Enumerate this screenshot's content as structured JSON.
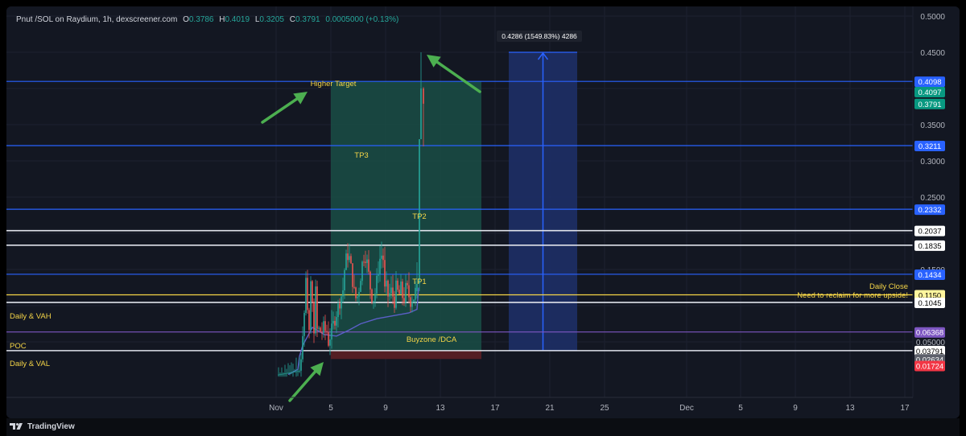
{
  "header": {
    "symbol": "Pnut /SOL on Raydium, 1h, dexscreener.com",
    "o_label": "O",
    "o_value": "0.3786",
    "h_label": "H",
    "h_value": "0.4019",
    "l_label": "L",
    "l_value": "0.3205",
    "c_label": "C",
    "c_value": "0.3791",
    "change": "0.0005000 (+0.13%)"
  },
  "footer": {
    "brand": "TradingView"
  },
  "colors": {
    "background": "#131722",
    "blue_line": "#2962ff",
    "white_line": "#e0e3eb",
    "poc_line": "#7e57c2",
    "vwap_line": "#5b5fc7",
    "target_box": "#1a4d45",
    "stop_box": "#5c1f25",
    "measure_box": "#1e2f66",
    "green_price": "#089981",
    "red_price": "#f23645",
    "label_yellow": "#f5d547",
    "arrow_green": "#4caf50",
    "candle_up": "#26a69a",
    "candle_down": "#ef5350"
  },
  "chart_data": {
    "type": "candlestick",
    "title": "Pnut /SOL on Raydium, 1h, dexscreener.com",
    "y_ticks": [
      "0.5000",
      "0.4500",
      "0.4000",
      "0.3500",
      "0.3000",
      "0.2500",
      "0.1500",
      "0.05000"
    ],
    "x_ticks": [
      "Nov",
      "5",
      "9",
      "13",
      "17",
      "21",
      "25",
      "Dec",
      "5",
      "9",
      "13",
      "17"
    ],
    "price_range": [
      0.0,
      0.5
    ],
    "horizontal_levels": [
      {
        "value": 0.4098,
        "label": "0.4098",
        "style": "blue"
      },
      {
        "value": 0.3211,
        "label": "0.3211",
        "style": "blue"
      },
      {
        "value": 0.2332,
        "label": "0.2332",
        "style": "blue"
      },
      {
        "value": 0.2037,
        "label": "0.2037",
        "style": "white"
      },
      {
        "value": 0.1835,
        "label": "0.1835",
        "style": "white"
      },
      {
        "value": 0.1434,
        "label": "0.1434",
        "style": "blue"
      },
      {
        "value": 0.115,
        "label": "0.1150",
        "style": "yellow"
      },
      {
        "value": 0.1045,
        "label": "0.1045",
        "style": "white"
      },
      {
        "value": 0.06368,
        "label": "0.06368",
        "style": "purple"
      },
      {
        "value": 0.03791,
        "label": "0.03791",
        "style": "white"
      }
    ],
    "price_badges": [
      {
        "value": 0.4097,
        "label": "0.4097",
        "style": "green"
      },
      {
        "value": 0.3791,
        "label": "0.3791",
        "style": "green"
      },
      {
        "value": 0.02634,
        "label": "0.02634",
        "style": "gray"
      },
      {
        "value": 0.01724,
        "label": "0.01724",
        "style": "red"
      }
    ],
    "annotations": {
      "higher_target": "Higher Target",
      "tp3": "TP3",
      "tp2": "TP2",
      "tp1": "TP1",
      "daily_close": "Daily Close",
      "reclaim": "Need to reclaim for more upside!",
      "daily_vah": "Daily & VAH",
      "poc": "POC",
      "daily_val": "Daily & VAL",
      "buyzone": "Buyzone /DCA",
      "measure": "0.4286 (1549.83%) 4286"
    },
    "position_box": {
      "entry": 0.03791,
      "target": 0.4098,
      "stop": 0.02634,
      "x_start_day": 5,
      "x_end_day": 16
    },
    "measure_box": {
      "low": 0.03791,
      "high": 0.45,
      "x_start_day": 18,
      "x_end_day": 23
    },
    "candles_summary": {
      "consolidation_range": [
        0.055,
        0.19
      ],
      "breakout_high": 0.45,
      "last_close": 0.3791
    }
  }
}
